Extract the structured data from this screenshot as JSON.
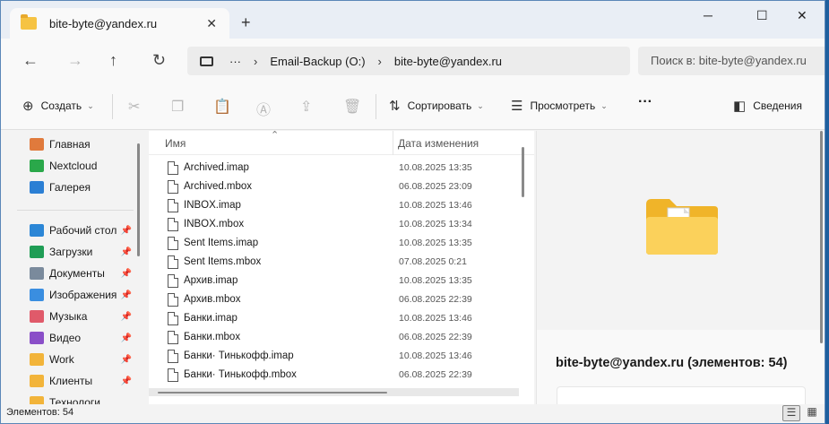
{
  "window": {
    "tab_title": "bite-byte@yandex.ru",
    "tab_close": "✕",
    "new_tab": "+",
    "minimize": "─",
    "maximize": "☐",
    "close": "✕"
  },
  "nav_buttons": {
    "back": "←",
    "forward": "→",
    "up": "↑",
    "refresh": "↻"
  },
  "address": {
    "more": "···",
    "sep1": "›",
    "crumb1": "Email-Backup (O:)",
    "sep2": "›",
    "crumb2": "bite-byte@yandex.ru"
  },
  "search": {
    "placeholder": "Поиск в: bite-byte@yandex.ru"
  },
  "toolbar": {
    "create_icon": "⊕",
    "create": "Создать",
    "cut_icon": "✂",
    "copy_icon": "❐",
    "paste_icon": "📋",
    "rename_icon": "Ⓐ",
    "share_icon": "⇪",
    "delete_icon": "🗑",
    "sort_icon": "⇅",
    "sort": "Сортировать",
    "view_icon": "☰",
    "view": "Просмотреть",
    "more": "···",
    "details_icon": "◧",
    "details": "Сведения",
    "chevron": "⌄"
  },
  "sidebar": {
    "items": [
      {
        "label": "Главная",
        "icon": "home-icon",
        "color": "#e07a3c"
      },
      {
        "label": "Nextcloud",
        "icon": "nextcloud-icon",
        "color": "#2aa84a"
      },
      {
        "label": "Галерея",
        "icon": "gallery-icon",
        "color": "#2b7fd4"
      },
      {
        "label": "Рабочий стол",
        "icon": "desktop-icon",
        "color": "#2b86d6",
        "pinned": true
      },
      {
        "label": "Загрузки",
        "icon": "download-icon",
        "color": "#1f9d55",
        "pinned": true
      },
      {
        "label": "Документы",
        "icon": "documents-icon",
        "color": "#7a8a9c",
        "pinned": true
      },
      {
        "label": "Изображения",
        "icon": "pictures-icon",
        "color": "#3a8ee0",
        "pinned": true
      },
      {
        "label": "Музыка",
        "icon": "music-icon",
        "color": "#e05a6a",
        "pinned": true
      },
      {
        "label": "Видео",
        "icon": "video-icon",
        "color": "#8a4fc8",
        "pinned": true
      },
      {
        "label": "Work",
        "icon": "folder-sync-icon",
        "color": "#f2b43a",
        "pinned": true
      },
      {
        "label": "Клиенты",
        "icon": "folder-sync-icon",
        "color": "#f2b43a",
        "pinned": true
      },
      {
        "label": "Технологи",
        "icon": "folder-sync-icon",
        "color": "#f2b43a",
        "pinned": false
      }
    ],
    "pin_icon": "📌"
  },
  "list": {
    "col_name": "Имя",
    "col_date": "Дата изменения",
    "sort_arrow": "⌃",
    "rows": [
      {
        "name": "Archived.imap",
        "date": "10.08.2025 13:35"
      },
      {
        "name": "Archived.mbox",
        "date": "06.08.2025 23:09"
      },
      {
        "name": "INBOX.imap",
        "date": "10.08.2025 13:46"
      },
      {
        "name": "INBOX.mbox",
        "date": "10.08.2025 13:34"
      },
      {
        "name": "Sent Items.imap",
        "date": "10.08.2025 13:35"
      },
      {
        "name": "Sent Items.mbox",
        "date": "07.08.2025 0:21"
      },
      {
        "name": "Архив.imap",
        "date": "10.08.2025 13:35"
      },
      {
        "name": "Архив.mbox",
        "date": "06.08.2025 22:39"
      },
      {
        "name": "Банки.imap",
        "date": "10.08.2025 13:46"
      },
      {
        "name": "Банки.mbox",
        "date": "06.08.2025 22:39"
      },
      {
        "name": "Банки· Тинькофф.imap",
        "date": "10.08.2025 13:46"
      },
      {
        "name": "Банки· Тинькофф.mbox",
        "date": "06.08.2025 22:39"
      }
    ]
  },
  "preview": {
    "title": "bite-byte@yandex.ru (элементов: 54)"
  },
  "status": {
    "text": "Элементов: 54",
    "details_view": "☰",
    "tiles_view": "▦"
  }
}
